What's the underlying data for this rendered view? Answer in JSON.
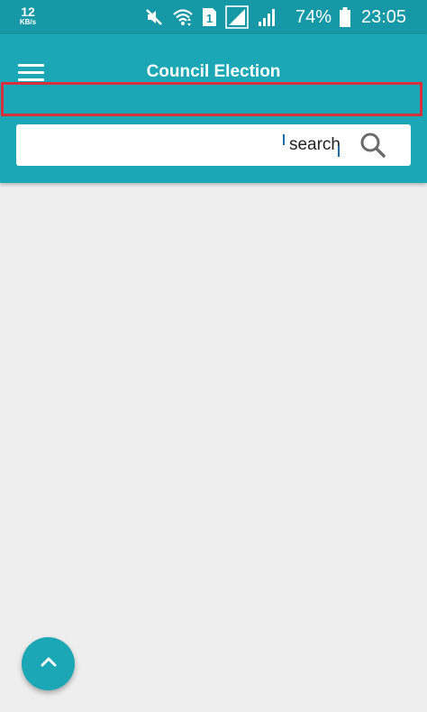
{
  "status_bar": {
    "net_speed_value": "12",
    "net_speed_unit": "KB/s",
    "icons": [
      "mute-icon",
      "wifi-icon",
      "sim-1-icon",
      "signal-icon",
      "signal-icon"
    ],
    "battery_percent": "74%",
    "time": "23:05"
  },
  "app_bar": {
    "title": "Council Election",
    "menu_icon": "hamburger-menu-icon"
  },
  "search": {
    "placeholder": "search",
    "value": "",
    "icon": "search-icon"
  },
  "fab": {
    "icon": "chevron-up-icon"
  },
  "colors": {
    "status_bar": "#1798a6",
    "app_bar": "#1ba7b5",
    "highlight_border": "#d6303c",
    "background": "#eeeeee"
  }
}
